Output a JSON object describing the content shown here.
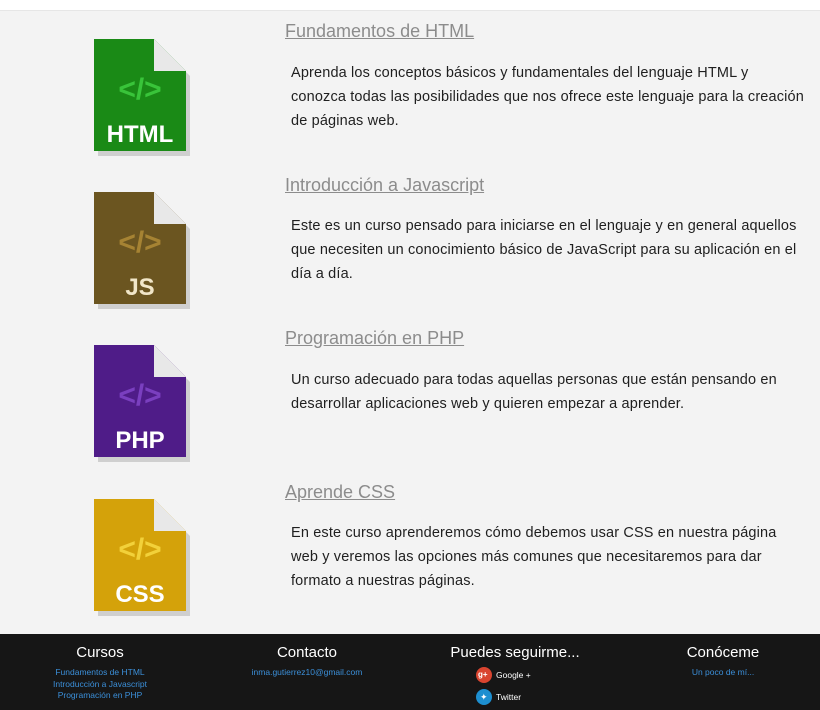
{
  "courses": [
    {
      "icon_label": "HTML",
      "icon_color": "#1a8a16",
      "icon_shadow": "#116c0f",
      "icon_glyph_color": "#39c43a",
      "title": "Fundamentos de HTML",
      "description": "Aprenda los conceptos básicos y fundamentales del lenguaje HTML y conozca todas las posibilidades que nos ofrece este lenguaje para la creación de páginas web."
    },
    {
      "icon_label": "JS",
      "icon_color": "#6b5520",
      "icon_shadow": "#533f14",
      "icon_glyph_color": "#a68333",
      "title": "Introducción a Javascript",
      "description": "Este es un curso pensado para iniciarse en el lenguaje y en general aquellos que necesiten un conocimiento básico de JavaScript para su aplicación en el día a día."
    },
    {
      "icon_label": "PHP",
      "icon_color": "#4f1c88",
      "icon_shadow": "#3c136a",
      "icon_glyph_color": "#7a3fbf",
      "title": "Programación en PHP",
      "description": "Un curso adecuado para todas aquellas personas que están pensando en desarrollar aplicaciones web y quieren empezar a aprender."
    },
    {
      "icon_label": "CSS",
      "icon_color": "#d4a20a",
      "icon_shadow": "#b0850a",
      "icon_glyph_color": "#f2d13a",
      "title": "Aprende CSS",
      "description": "En este curso aprenderemos cómo debemos usar CSS en nuestra página web y veremos las opciones más comunes que necesitaremos para dar formato a nuestras páginas."
    }
  ],
  "footer": {
    "cursos": {
      "heading": "Cursos",
      "links": [
        "Fundamentos de HTML",
        "Introducción a Javascript",
        "Programación en PHP"
      ]
    },
    "contacto": {
      "heading": "Contacto",
      "email": "inma.gutierrez10@gmail.com"
    },
    "seguirme": {
      "heading": "Puedes seguirme...",
      "googleplus_label": "Google +",
      "googleplus_color": "#d9442f",
      "twitter_label": "Twitter",
      "twitter_color": "#1d8fd0"
    },
    "conoceme": {
      "heading": "Conóceme",
      "link": "Un poco de mí..."
    }
  }
}
